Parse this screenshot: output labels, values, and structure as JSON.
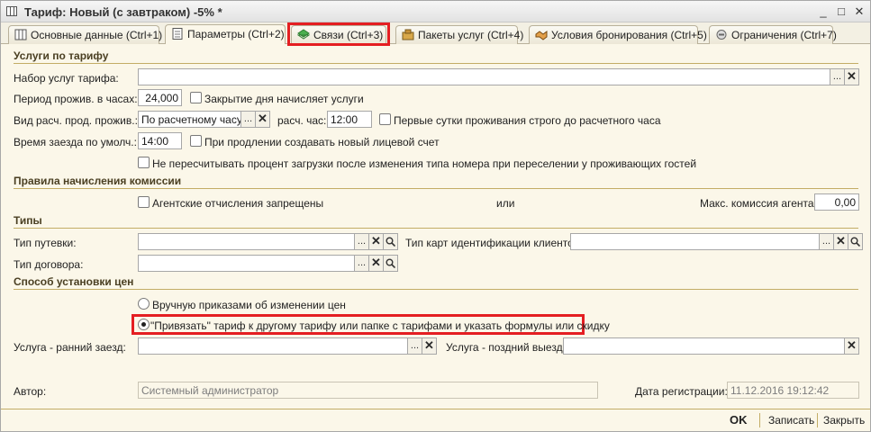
{
  "window": {
    "title": "Тариф: Новый (с завтраком) -5% *",
    "minimize": "_",
    "maximize": "□",
    "close": "✕"
  },
  "tabs": [
    {
      "label": "Основные данные (Ctrl+1)",
      "icon": "table-icon"
    },
    {
      "label": "Параметры (Ctrl+2)",
      "icon": "document-icon",
      "active": true
    },
    {
      "label": "Связи (Ctrl+3)",
      "icon": "links-icon",
      "highlighted": true
    },
    {
      "label": "Пакеты услуг (Ctrl+4)",
      "icon": "package-icon"
    },
    {
      "label": "Условия бронирования (Ctrl+5)",
      "icon": "handshake-icon"
    },
    {
      "label": "Ограничения (Ctrl+7)",
      "icon": "restriction-icon"
    }
  ],
  "services": {
    "header": "Услуги по тарифу",
    "service_set_label": "Набор услуг тарифа:",
    "service_set_value": "",
    "period_label": "Период прожив. в часах:",
    "period_value": "24,000",
    "close_day_label": "Закрытие дня начисляет услуги",
    "calc_type_label": "Вид расч. прод. прожив.:",
    "calc_type_value": "По расчетному часу",
    "calc_hour_label": "расч. час:",
    "calc_hour_value": "12:00",
    "first_day_label": "Первые сутки проживания строго до расчетного часа",
    "checkin_label": "Время заезда по умолч.:",
    "checkin_value": "14:00",
    "new_account_label": "При продлении создавать новый лицевой счет",
    "no_recalc_label": "Не пересчитывать процент загрузки после изменения типа номера при переселении у проживающих гостей"
  },
  "commission": {
    "header": "Правила начисления комиссии",
    "agent_forbidden_label": "Агентские отчисления запрещены",
    "or_label": "или",
    "max_commission_label": "Макс. комиссия агента:",
    "max_commission_value": "0,00"
  },
  "types": {
    "header": "Типы",
    "voucher_label": "Тип путевки:",
    "voucher_value": "",
    "card_type_label": "Тип карт идентификации клиентов:",
    "card_type_value": "",
    "contract_label": "Тип договора:",
    "contract_value": ""
  },
  "price_method": {
    "header": "Способ установки цен",
    "manual_label": "Вручную приказами об изменении цен",
    "link_label": "\"Привязать\" тариф к другому тарифу или папке с тарифами и указать формулы или скидку",
    "selected": "link",
    "early_label": "Услуга - ранний заезд:",
    "early_value": "",
    "late_label": "Услуга - поздний выезд:",
    "late_value": ""
  },
  "meta": {
    "author_label": "Автор:",
    "author_value": "Системный администратор",
    "reg_date_label": "Дата регистрации:",
    "reg_date_value": "11.12.2016 19:12:42"
  },
  "footer": {
    "ok": "OK",
    "save": "Записать",
    "close": "Закрыть"
  },
  "buttons": {
    "select": "...",
    "clear": "✕"
  },
  "colors": {
    "form_bg": "#fbf7e9",
    "section_text": "#4a3f22",
    "section_line": "#c3ad66",
    "highlight": "#e41e22"
  }
}
